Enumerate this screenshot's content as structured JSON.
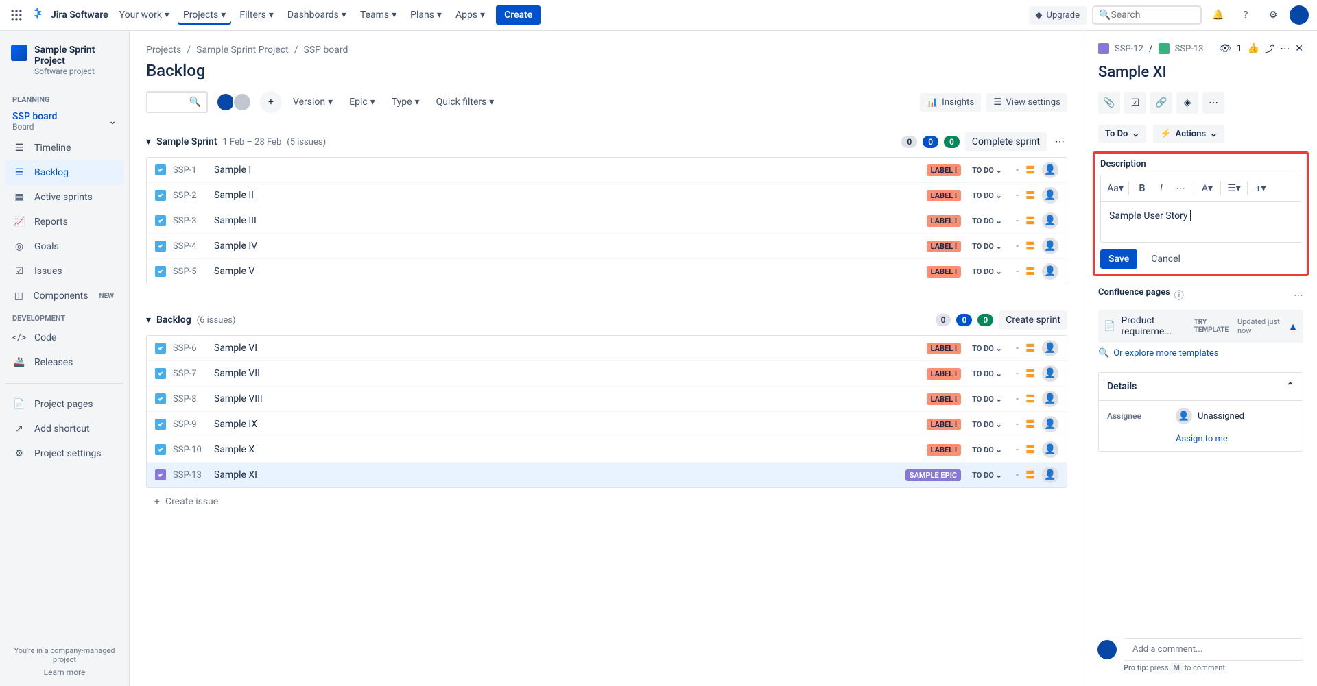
{
  "nav": {
    "logo": "Jira Software",
    "items": [
      "Your work",
      "Projects",
      "Filters",
      "Dashboards",
      "Teams",
      "Plans",
      "Apps"
    ],
    "create": "Create",
    "upgrade": "Upgrade",
    "search_placeholder": "Search"
  },
  "sidebar": {
    "project_name": "Sample Sprint Project",
    "project_type": "Software project",
    "planning_label": "PLANNING",
    "board_name": "SSP board",
    "board_sub": "Board",
    "items_planning": [
      "Timeline",
      "Backlog",
      "Active sprints",
      "Reports",
      "Goals",
      "Issues",
      "Components"
    ],
    "new_label": "NEW",
    "development_label": "DEVELOPMENT",
    "items_dev": [
      "Code",
      "Releases"
    ],
    "items_other": [
      "Project pages",
      "Add shortcut",
      "Project settings"
    ],
    "footer_text": "You're in a company-managed project",
    "learn_more": "Learn more"
  },
  "breadcrumb": [
    "Projects",
    "Sample Sprint Project",
    "SSP board"
  ],
  "page_title": "Backlog",
  "toolbar": {
    "filters": [
      "Version",
      "Epic",
      "Type",
      "Quick filters"
    ],
    "insights": "Insights",
    "view_settings": "View settings"
  },
  "sprint": {
    "title": "Sample Sprint",
    "dates": "1 Feb – 28 Feb",
    "count": "(5 issues)",
    "badges": [
      "0",
      "0",
      "0"
    ],
    "complete": "Complete sprint",
    "issues": [
      {
        "key": "SSP-1",
        "summary": "Sample I",
        "label": "LABEL I",
        "status": "TO DO"
      },
      {
        "key": "SSP-2",
        "summary": "Sample II",
        "label": "LABEL I",
        "status": "TO DO"
      },
      {
        "key": "SSP-3",
        "summary": "Sample III",
        "label": "LABEL I",
        "status": "TO DO"
      },
      {
        "key": "SSP-4",
        "summary": "Sample IV",
        "label": "LABEL I",
        "status": "TO DO"
      },
      {
        "key": "SSP-5",
        "summary": "Sample V",
        "label": "LABEL I",
        "status": "TO DO"
      }
    ]
  },
  "backlog": {
    "title": "Backlog",
    "count": "(6 issues)",
    "badges": [
      "0",
      "0",
      "0"
    ],
    "create_sprint": "Create sprint",
    "issues": [
      {
        "key": "SSP-6",
        "summary": "Sample VI",
        "label": "LABEL I",
        "status": "TO DO",
        "type": "story"
      },
      {
        "key": "SSP-7",
        "summary": "Sample VII",
        "label": "LABEL I",
        "status": "TO DO",
        "type": "story"
      },
      {
        "key": "SSP-8",
        "summary": "Sample VIII",
        "label": "LABEL I",
        "status": "TO DO",
        "type": "story"
      },
      {
        "key": "SSP-9",
        "summary": "Sample IX",
        "label": "LABEL I",
        "status": "TO DO",
        "type": "story"
      },
      {
        "key": "SSP-10",
        "summary": "Sample X",
        "label": "LABEL I",
        "status": "TO DO",
        "type": "story"
      },
      {
        "key": "SSP-13",
        "summary": "Sample XI",
        "label": "SAMPLE EPIC",
        "status": "TO DO",
        "type": "epic",
        "selected": true
      }
    ],
    "create_issue": "Create issue"
  },
  "detail": {
    "parent_key": "SSP-12",
    "key": "SSP-13",
    "watchers": "1",
    "title": "Sample XI",
    "status": "To Do",
    "actions": "Actions",
    "description_label": "Description",
    "description_text": "Sample User Story",
    "save": "Save",
    "cancel": "Cancel",
    "confluence_label": "Confluence pages",
    "confluence_item": "Product requireme...",
    "try_template": "TRY TEMPLATE",
    "updated": "Updated just now",
    "explore": "Or explore more templates",
    "details_label": "Details",
    "assignee_label": "Assignee",
    "assignee_value": "Unassigned",
    "assign_me": "Assign to me",
    "comment_placeholder": "Add a comment...",
    "pro_tip_label": "Pro tip:",
    "pro_tip_text": "press",
    "pro_tip_key": "M",
    "pro_tip_end": "to comment"
  }
}
